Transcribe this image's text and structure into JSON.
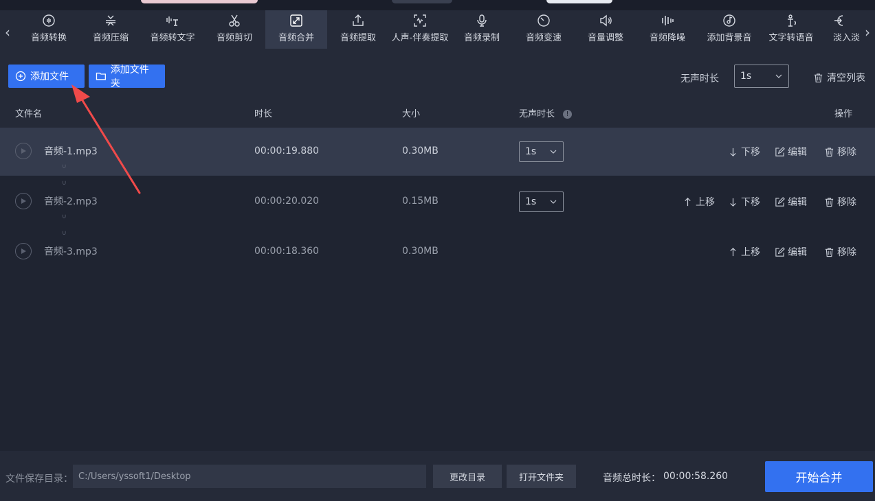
{
  "nav": {
    "prev_arrow": "‹",
    "next_arrow": "›"
  },
  "tools": [
    {
      "label": "音频转换",
      "icon": "audio-convert-icon"
    },
    {
      "label": "音频压缩",
      "icon": "compress-icon"
    },
    {
      "label": "音频转文字",
      "icon": "speech-to-text-icon"
    },
    {
      "label": "音频剪切",
      "icon": "scissors-icon"
    },
    {
      "label": "音频合并",
      "icon": "merge-icon",
      "active": true
    },
    {
      "label": "音频提取",
      "icon": "extract-icon"
    },
    {
      "label": "人声-伴奏提取",
      "icon": "vocal-separate-icon"
    },
    {
      "label": "音频录制",
      "icon": "microphone-icon"
    },
    {
      "label": "音频变速",
      "icon": "speed-icon"
    },
    {
      "label": "音量调整",
      "icon": "volume-icon"
    },
    {
      "label": "音频降噪",
      "icon": "denoise-icon"
    },
    {
      "label": "添加背景音",
      "icon": "bg-music-icon"
    },
    {
      "label": "文字转语音",
      "icon": "text-to-speech-icon"
    },
    {
      "label": "淡入淡",
      "icon": "fade-icon"
    }
  ],
  "actions": {
    "add_file": "添加文件",
    "add_folder": "添加文件夹",
    "silence_label": "无声时长",
    "silence_value": "1s",
    "clear_list": "清空列表"
  },
  "table": {
    "headers": {
      "name": "文件名",
      "duration": "时长",
      "size": "大小",
      "silence": "无声时长",
      "ops": "操作"
    },
    "info_glyph": "!",
    "spacer_glyph": "∪",
    "rows": [
      {
        "name": "音频-1.mp3",
        "duration": "00:00:19.880",
        "size": "0.30MB",
        "silence": "1s",
        "up": "",
        "down": "下移",
        "edit": "编辑",
        "remove": "移除"
      },
      {
        "name": "音频-2.mp3",
        "duration": "00:00:20.020",
        "size": "0.15MB",
        "silence": "1s",
        "up": "上移",
        "down": "下移",
        "edit": "编辑",
        "remove": "移除"
      },
      {
        "name": "音频-3.mp3",
        "duration": "00:00:18.360",
        "size": "0.30MB",
        "silence": "",
        "up": "上移",
        "down": "",
        "edit": "编辑",
        "remove": "移除"
      }
    ]
  },
  "footer": {
    "save_dir_label": "文件保存目录：",
    "save_dir_value": "C:/Users/yssoft1/Desktop",
    "change_dir": "更改目录",
    "open_folder": "打开文件夹",
    "total_label": "音频总时长：",
    "total_value": "00:00:58.260",
    "start": "开始合并"
  },
  "colors": {
    "accent": "#3371f0",
    "annotation_arrow": "#f04a4a",
    "background": "#1f2431",
    "panel": "#252a38"
  }
}
